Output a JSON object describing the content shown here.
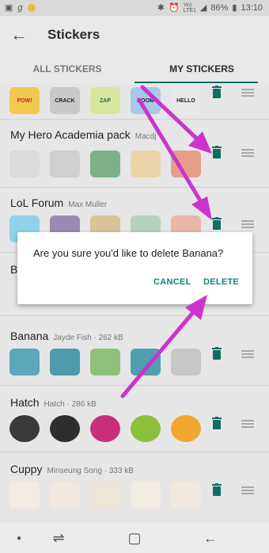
{
  "status_bar": {
    "battery": "86%",
    "time": "13:10",
    "network": "VoLTE LTE1",
    "network_small_top": "Vo)",
    "network_small_bottom": "LTE1"
  },
  "app_bar": {
    "title": "Stickers"
  },
  "tabs": {
    "all": "ALL STICKERS",
    "mine": "MY STICKERS"
  },
  "colors": {
    "accent": "#0f6e62",
    "dialog_button": "#13837a",
    "arrow": "#cc33cc"
  },
  "packs": [
    {
      "name": "",
      "meta": "",
      "stickers": [
        "POW!",
        "CRACK",
        "ZAP",
        "BOOM",
        "HELLO"
      ]
    },
    {
      "name": "My Hero Academia pack",
      "meta": "Macdj",
      "stickers": [
        "",
        "",
        "",
        "",
        ""
      ]
    },
    {
      "name": "LoL Forum",
      "meta": "Max Muller",
      "stickers": [
        "",
        "",
        "",
        "",
        ""
      ]
    },
    {
      "name": "B",
      "meta": "",
      "stickers": [
        "",
        "",
        "",
        "",
        ""
      ]
    },
    {
      "name": "Banana",
      "meta": "Jayde Fish · 262 kB",
      "stickers": [
        "",
        "",
        "",
        "",
        ""
      ]
    },
    {
      "name": "Hatch",
      "meta": "Hatch · 286 kB",
      "stickers": [
        "",
        "",
        "",
        "",
        ""
      ]
    },
    {
      "name": "Cuppy",
      "meta": "Minseung Song · 333 kB",
      "stickers": [
        "",
        "",
        "",
        "",
        ""
      ]
    }
  ],
  "dialog": {
    "message": "Are you sure you'd like to delete Banana?",
    "cancel_label": "CANCEL",
    "delete_label": "DELETE"
  },
  "icons": {
    "back": "arrow-left-icon",
    "trash": "trash-icon",
    "drag": "drag-handle-icon"
  }
}
